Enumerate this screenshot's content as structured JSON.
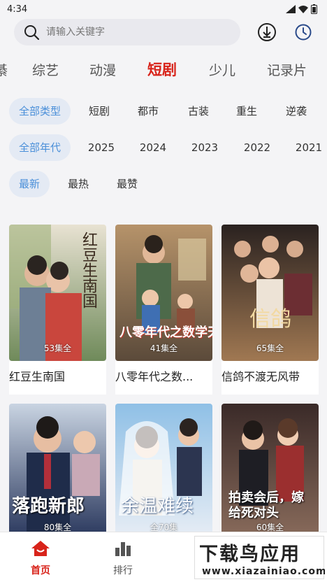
{
  "status": {
    "time": "4:34"
  },
  "search": {
    "placeholder": "请输入关键字"
  },
  "icons": {
    "download": "download-icon",
    "history": "history-clock-icon",
    "search": "search-icon"
  },
  "tabs": [
    {
      "label": "综艺",
      "active": false
    },
    {
      "label": "动漫",
      "active": false
    },
    {
      "label": "短剧",
      "active": true
    },
    {
      "label": "少儿",
      "active": false
    },
    {
      "label": "记录片",
      "active": false
    }
  ],
  "filters": {
    "type": [
      "全部类型",
      "短剧",
      "都市",
      "古装",
      "重生",
      "逆袭"
    ],
    "year": [
      "全部年代",
      "2025",
      "2024",
      "2023",
      "2022",
      "2021"
    ],
    "sort": [
      "最新",
      "最热",
      "最赞"
    ]
  },
  "cards": [
    {
      "title": "红豆生南国",
      "episodes": "53集全",
      "poster_text": "红豆生南国"
    },
    {
      "title": "八零年代之数...",
      "episodes": "41集全",
      "poster_text": "八零年代之数学天才"
    },
    {
      "title": "信鸽不渡无风带",
      "episodes": "65集全",
      "poster_text": "信鸽"
    },
    {
      "title": "",
      "episodes": "80集全",
      "poster_text": "落跑新郎"
    },
    {
      "title": "",
      "episodes": "全70集",
      "poster_text": "余温难续"
    },
    {
      "title": "",
      "episodes": "60集全",
      "poster_text": "拍卖会后，嫁给死对头"
    }
  ],
  "bottom_nav": [
    {
      "label": "首页",
      "icon": "home-icon",
      "active": true
    },
    {
      "label": "排行",
      "icon": "ranking-icon",
      "active": false
    },
    {
      "label": "",
      "icon": "",
      "active": false
    }
  ],
  "watermark": {
    "title": "下载鸟应用",
    "url": "www.xiazainiao.com"
  },
  "colors": {
    "accent": "#d8231a",
    "chip_active_bg": "#e4eaf4",
    "chip_active_text": "#4a8fd9"
  }
}
